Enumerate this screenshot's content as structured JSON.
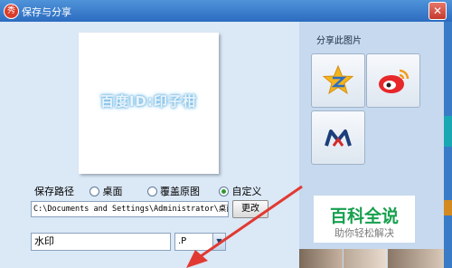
{
  "window": {
    "title": "保存与分享",
    "app_icon_char": "秀",
    "close_label": "✕"
  },
  "preview": {
    "watermark_text": "百度ID:印子柑"
  },
  "save_path": {
    "label": "保存路径",
    "options": [
      {
        "label": "桌面",
        "selected": false
      },
      {
        "label": "覆盖原图",
        "selected": false
      },
      {
        "label": "自定义",
        "selected": true
      }
    ],
    "path_value": "C:\\Documents and Settings\\Administrator\\桌面",
    "change_button": "更改"
  },
  "watermark": {
    "input_value": "水印",
    "select_value": ".P"
  },
  "share": {
    "label": "分享此图片",
    "buttons": [
      {
        "icon": "qzone-star-icon",
        "name": "Qzone"
      },
      {
        "icon": "weibo-icon",
        "name": "Weibo"
      },
      {
        "icon": "renren-icon",
        "name": "Renren"
      }
    ]
  },
  "ad": {
    "title": "百科全说",
    "subtitle": "助你轻松解决"
  },
  "colors": {
    "title_bar": "#2c6cc0",
    "arrow": "#e03a32",
    "ad_green": "#17a04e"
  }
}
